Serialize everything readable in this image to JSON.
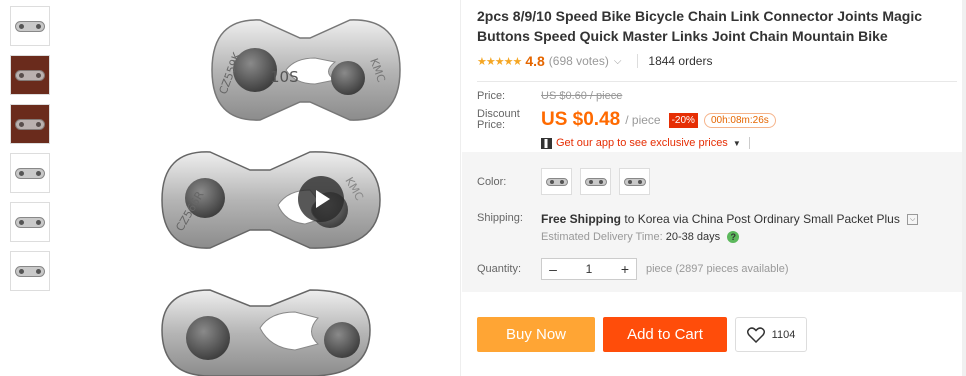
{
  "product": {
    "title": "2pcs 8/9/10 Speed Bike Bicycle Chain Link Connector Joints Magic Buttons Speed Quick Master Links Joint Chain Mountain Bike",
    "stars": "★★★★★",
    "rating": "4.8",
    "votes": "(698 votes)",
    "orders": "1844 orders"
  },
  "image_text": {
    "top_link": "10S",
    "top_stamp_left": "CZ559K",
    "top_stamp_right": "KMC",
    "mid_stamp_left": "CZ566R",
    "mid_stamp_right": "KMC"
  },
  "pricing": {
    "price_label": "Price:",
    "original_price": "US $0.60 / piece",
    "discount_label": "Discount Price:",
    "discount_price": "US $0.48",
    "per_unit": "/ piece",
    "discount_badge": "-20%",
    "timer": "00h:08m:26s",
    "app_promo": "Get our app to see exclusive prices"
  },
  "options": {
    "color_label": "Color:",
    "shipping_label": "Shipping:",
    "shipping_free": "Free Shipping",
    "shipping_rest": "to Korea via China Post Ordinary Small Packet Plus",
    "delivery_label": "Estimated Delivery Time:",
    "delivery_value": "20-38 days",
    "quantity_label": "Quantity:",
    "quantity_value": "1",
    "minus": "–",
    "plus": "+",
    "availability": "piece (2897 pieces available)"
  },
  "actions": {
    "buy_now": "Buy Now",
    "add_to_cart": "Add to Cart",
    "wishlist_count": "1104"
  },
  "colors": {
    "accent": "#ff6a00",
    "buy_now": "#ffa534",
    "add_to_cart": "#ff4d0a",
    "badge": "#e62e04"
  }
}
